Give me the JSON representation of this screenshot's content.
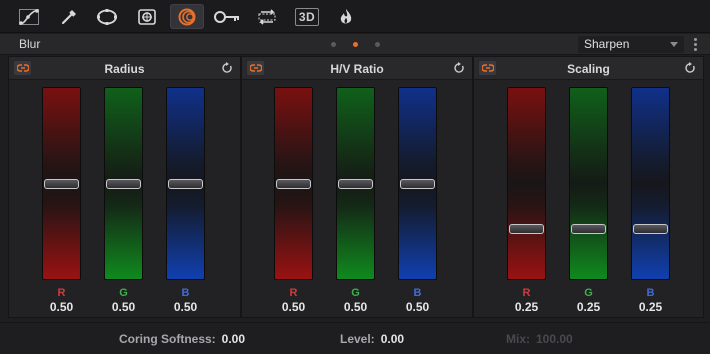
{
  "toolbar": {
    "tools": [
      {
        "name": "curves-icon",
        "active": false
      },
      {
        "name": "qualifier-eyedropper-icon",
        "active": false
      },
      {
        "name": "power-window-icon",
        "active": false
      },
      {
        "name": "tracker-icon",
        "active": false
      },
      {
        "name": "blur-icon",
        "active": true
      },
      {
        "name": "key-icon",
        "active": false
      },
      {
        "name": "sizing-icon",
        "active": false
      },
      {
        "name": "3d-label",
        "active": false
      },
      {
        "name": "effects-flame-icon",
        "active": false
      }
    ],
    "label_3d": "3D",
    "accent": "#e8702a"
  },
  "panel": {
    "title": "Blur",
    "page_dots": 3,
    "active_dot": 1,
    "mode": "Sharpen"
  },
  "groups": [
    {
      "title": "Radius",
      "channels": [
        {
          "label": "R",
          "value": "0.50",
          "level": 0.5
        },
        {
          "label": "G",
          "value": "0.50",
          "level": 0.5
        },
        {
          "label": "B",
          "value": "0.50",
          "level": 0.5
        }
      ]
    },
    {
      "title": "H/V Ratio",
      "channels": [
        {
          "label": "R",
          "value": "0.50",
          "level": 0.5
        },
        {
          "label": "G",
          "value": "0.50",
          "level": 0.5
        },
        {
          "label": "B",
          "value": "0.50",
          "level": 0.5
        }
      ]
    },
    {
      "title": "Scaling",
      "channels": [
        {
          "label": "R",
          "value": "0.25",
          "level": 0.25
        },
        {
          "label": "G",
          "value": "0.25",
          "level": 0.25
        },
        {
          "label": "B",
          "value": "0.25",
          "level": 0.25
        }
      ]
    }
  ],
  "footer": {
    "coring_label": "Coring Softness:",
    "coring_value": "0.00",
    "level_label": "Level:",
    "level_value": "0.00",
    "mix_label": "Mix:",
    "mix_value": "100.00",
    "mix_enabled": false
  }
}
